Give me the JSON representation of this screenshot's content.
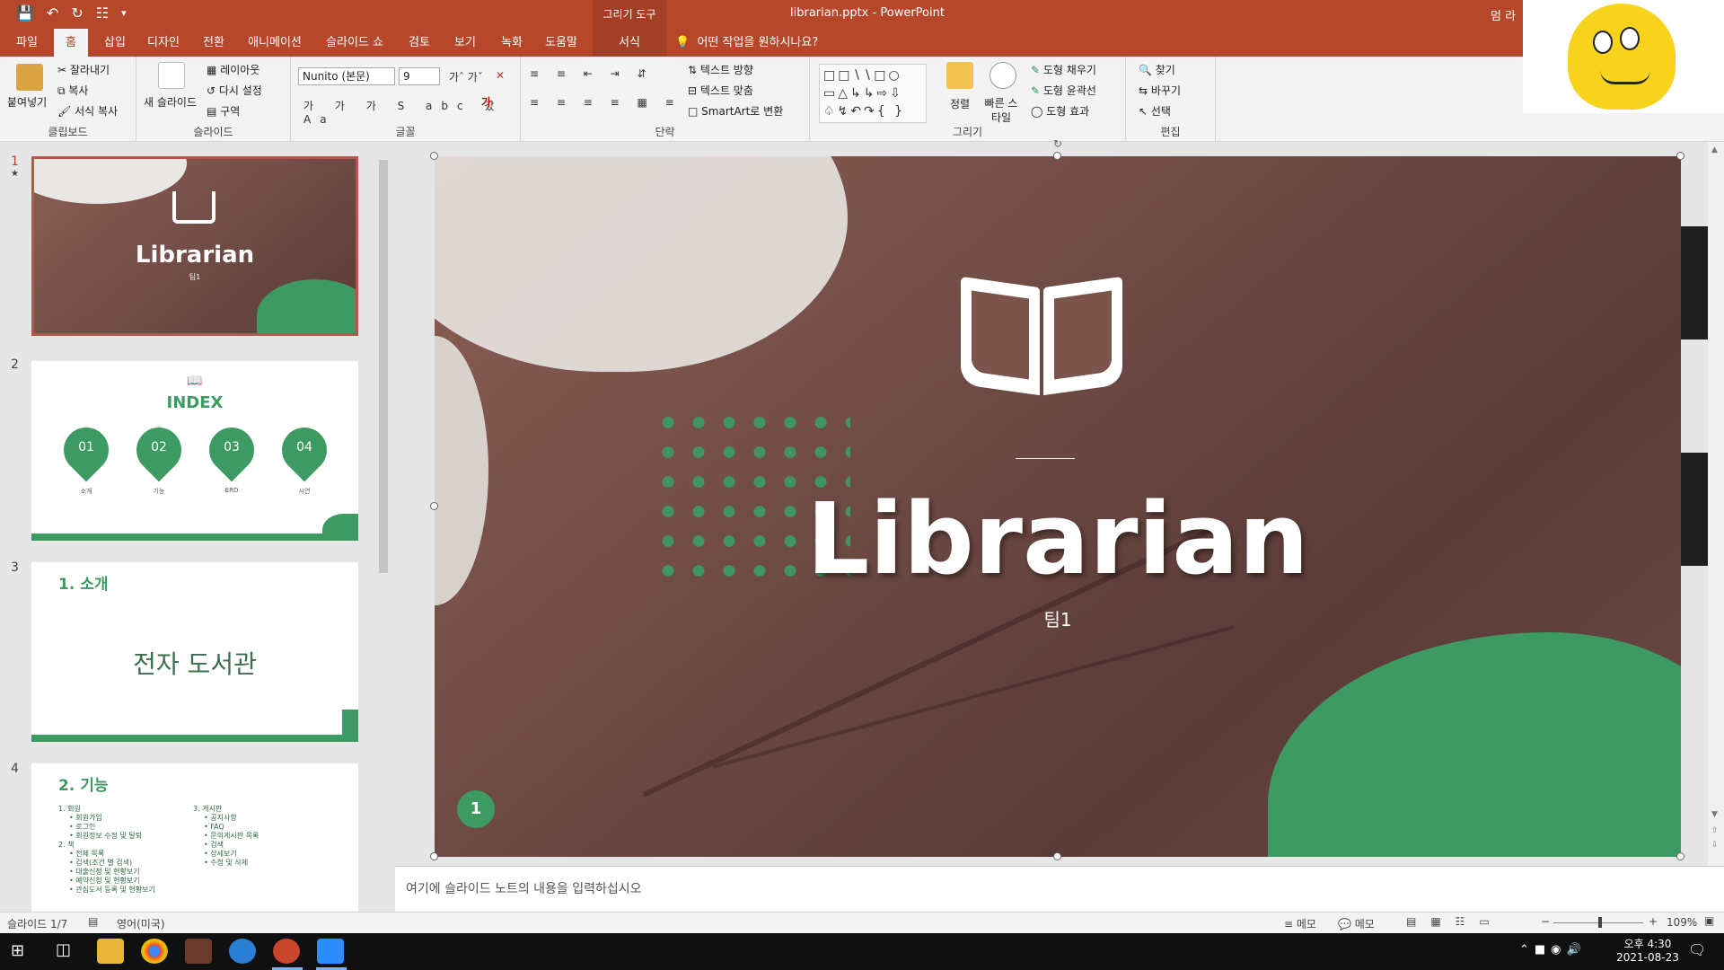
{
  "titlebar": {
    "context_tools": "그리기 도구",
    "file_name": "librarian.pptx",
    "separator": "-",
    "app_name": "PowerPoint",
    "user": "멈 라"
  },
  "tabs": [
    "파일",
    "홈",
    "삽입",
    "디자인",
    "전환",
    "애니메이션",
    "슬라이드 쇼",
    "검토",
    "보기",
    "녹화",
    "도움말",
    "서식"
  ],
  "tell_me": "어떤 작업을 원하시나요?",
  "ribbon": {
    "clipboard": {
      "paste": "붙여넣기",
      "cut": "잘라내기",
      "copy": "복사",
      "format_painter": "서식 복사",
      "label": "클립보드"
    },
    "slides": {
      "new_slide": "새 슬라이드",
      "layout": "레이아웃",
      "reset": "다시 설정",
      "section": "구역",
      "label": "슬라이드"
    },
    "font": {
      "font_name": "Nunito (본문)",
      "font_size": "9",
      "label": "글꼴"
    },
    "paragraph": {
      "text_direction": "텍스트 방향",
      "align_text": "텍스트 맞춤",
      "smartart": "SmartArt로 변환",
      "label": "단락"
    },
    "drawing": {
      "arrange": "정렬",
      "quick_styles": "빠른 스타일",
      "fill": "도형 채우기",
      "outline": "도형 윤곽선",
      "effects": "도형 효과",
      "label": "그리기"
    },
    "editing": {
      "find": "찾기",
      "replace": "바꾸기",
      "select": "선택",
      "label": "편집"
    }
  },
  "thumbnails": [
    {
      "num": "1",
      "star": "★",
      "title": "Librarian",
      "sub": "팀1"
    },
    {
      "num": "2",
      "title": "INDEX",
      "items": [
        "01",
        "02",
        "03",
        "04"
      ],
      "captions": [
        "소개",
        "기능",
        "ERD",
        "시연"
      ]
    },
    {
      "num": "3",
      "title": "1. 소개",
      "body": "전자 도서관"
    },
    {
      "num": "4",
      "title": "2. 기능",
      "col1": [
        "1. 회원",
        "• 회원가입",
        "• 로그인",
        "• 회원정보 수정 및 탈퇴",
        "2. 책",
        "• 전체 목록",
        "• 검색(조건 별 검색)",
        "• 대출신청 및 현황보기",
        "• 예약신청 및 현황보기",
        "• 관심도서 등록 및 현황보기"
      ],
      "col2": [
        "3. 게시판",
        "• 공지사항",
        "• FAQ",
        "• 문의게시판 목록",
        "• 검색",
        "• 상세보기",
        "• 수정 및 삭제"
      ]
    }
  ],
  "slide": {
    "title": "Librarian",
    "subtitle": "팀1",
    "page_badge": "1"
  },
  "notes_placeholder": "여기에 슬라이드 노트의 내용을 입력하십시오",
  "status": {
    "slide_of": "슬라이드 1/7",
    "language": "영어(미국)",
    "memo1": "메모",
    "memo2": "메모",
    "zoom": "109%"
  },
  "taskbar": {
    "time": "오후 4:30",
    "date": "2021-08-23"
  },
  "colors": {
    "accent": "#b7472a",
    "green": "#3d9a62"
  }
}
